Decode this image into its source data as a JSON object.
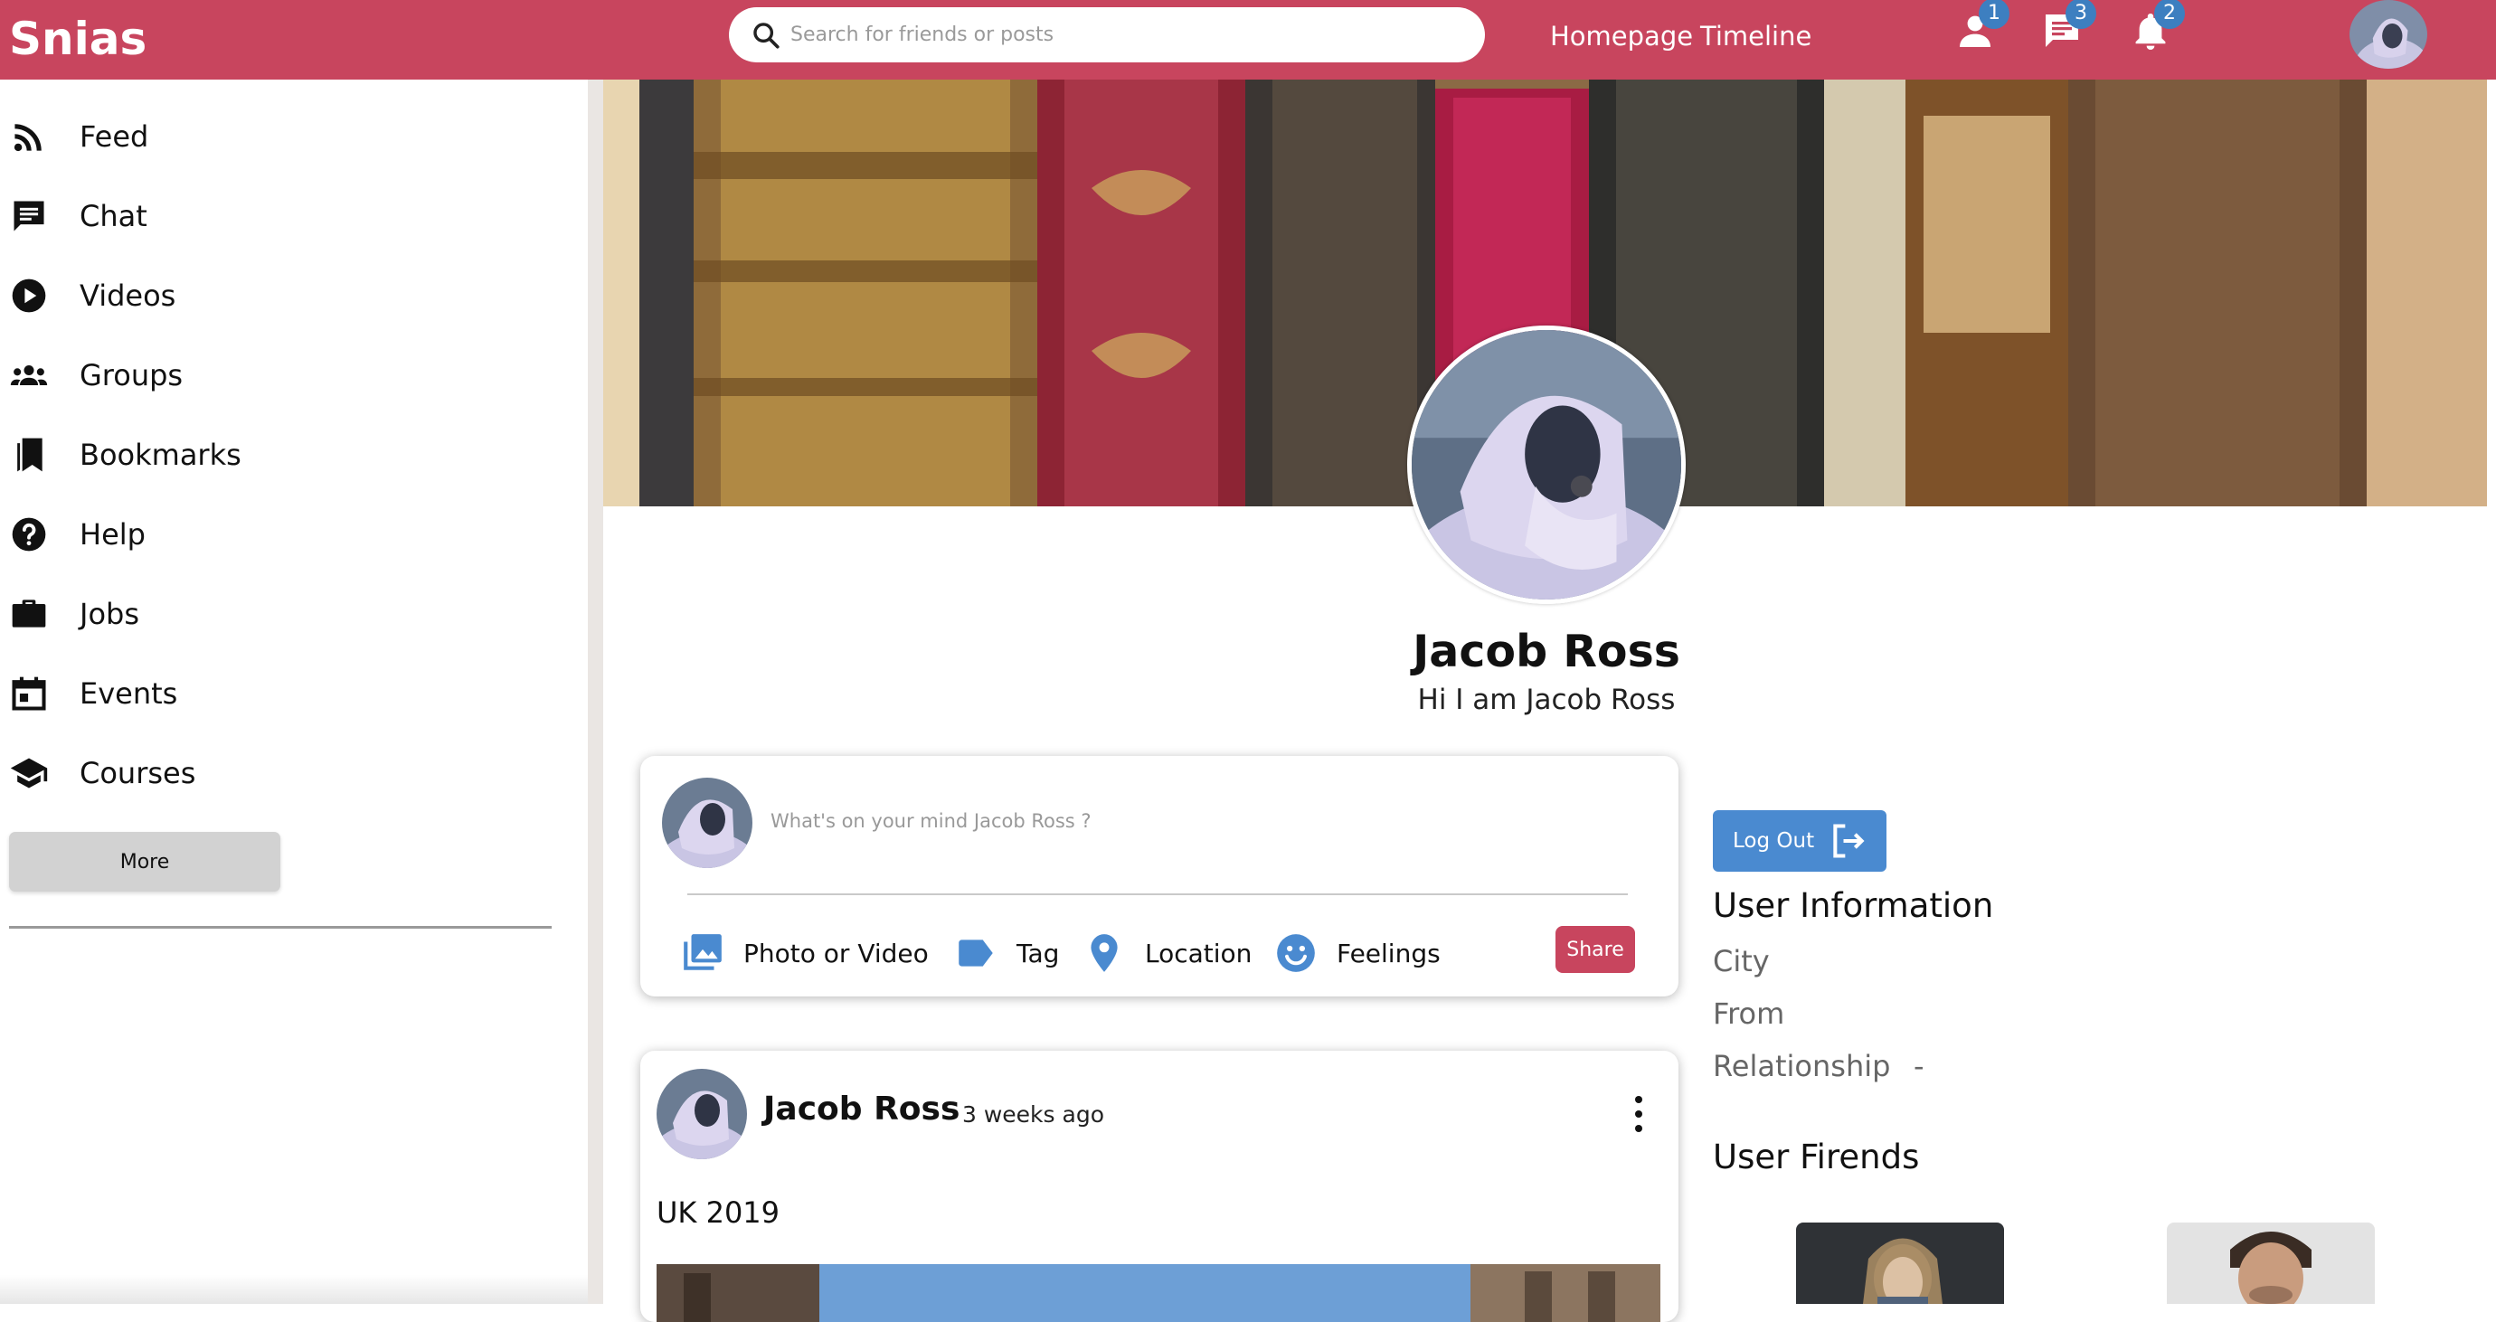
{
  "app": {
    "logo": "Snias"
  },
  "topbar": {
    "search_placeholder": "Search for friends or posts",
    "nav": {
      "homepage": "Homepage",
      "timeline": "Timeline"
    },
    "badges": {
      "friends": "1",
      "messages": "3",
      "notifications": "2"
    },
    "icons": {
      "search": "search-icon",
      "friends": "person-icon",
      "messages": "chat-icon",
      "notifications": "bell-icon"
    }
  },
  "sidebar": {
    "items": [
      {
        "label": "Feed",
        "icon": "rss-feed-icon"
      },
      {
        "label": "Chat",
        "icon": "chat-icon"
      },
      {
        "label": "Videos",
        "icon": "play-circle-icon"
      },
      {
        "label": "Groups",
        "icon": "group-icon"
      },
      {
        "label": "Bookmarks",
        "icon": "bookmark-icon"
      },
      {
        "label": "Help",
        "icon": "help-circle-icon"
      },
      {
        "label": "Jobs",
        "icon": "briefcase-icon"
      },
      {
        "label": "Events",
        "icon": "calendar-icon"
      },
      {
        "label": "Courses",
        "icon": "school-icon"
      }
    ],
    "more_label": "More"
  },
  "profile": {
    "name": "Jacob Ross",
    "description": "Hi I am Jacob Ross"
  },
  "share": {
    "placeholder": "What's on your mind Jacob Ross ?",
    "options": {
      "photo": "Photo or Video",
      "tag": "Tag",
      "location": "Location",
      "feelings": "Feelings"
    },
    "share_label": "Share"
  },
  "post": {
    "author": "Jacob Ross",
    "time": "3 weeks ago",
    "text": "UK 2019"
  },
  "user_info": {
    "logout_label": "Log Out",
    "title": "User Information",
    "rows": [
      {
        "label": "City",
        "value": ""
      },
      {
        "label": "From",
        "value": ""
      },
      {
        "label": "Relationship",
        "value": "-"
      }
    ],
    "friends_title": "User Firends"
  },
  "colors": {
    "brand": "#c8455e",
    "accent_blue": "#4a8ad0",
    "badge_blue": "#3d7fc0"
  }
}
